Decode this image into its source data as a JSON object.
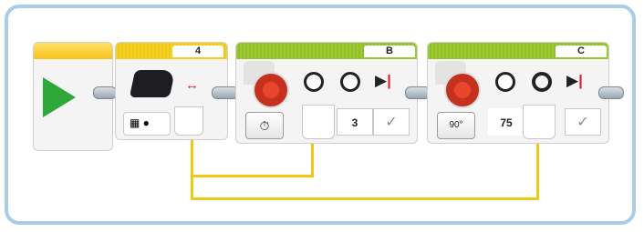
{
  "colors": {
    "frame_border": "#a9cde9",
    "flow_yellow": "#f0c814",
    "motor_green": "#8fbe29",
    "start_green": "#2fa83a",
    "accent_red": "#e0222c"
  },
  "program": {
    "start_block": {
      "icon": "play-icon"
    },
    "sensor_block": {
      "port": "4",
      "icons": [
        "ultrasonic-sensor-icon",
        "distance-arrows-icon",
        "measure-mode-icon"
      ]
    },
    "motor_b": {
      "port": "B",
      "mode_icon": "time-mode-icon",
      "inputs": {
        "power": "",
        "seconds": "3",
        "brake": "✓"
      },
      "icons": [
        "medium-motor-icon",
        "speed-gauge-icon",
        "timer-icon",
        "brake-icon"
      ]
    },
    "motor_c": {
      "port": "C",
      "mode_icon": "degrees-mode-icon",
      "mode_label": "90°",
      "inputs": {
        "power": "",
        "degrees": "75",
        "brake": "✓"
      },
      "icons": [
        "medium-motor-icon",
        "speed-gauge-icon",
        "degrees-icon",
        "brake-icon"
      ]
    }
  }
}
